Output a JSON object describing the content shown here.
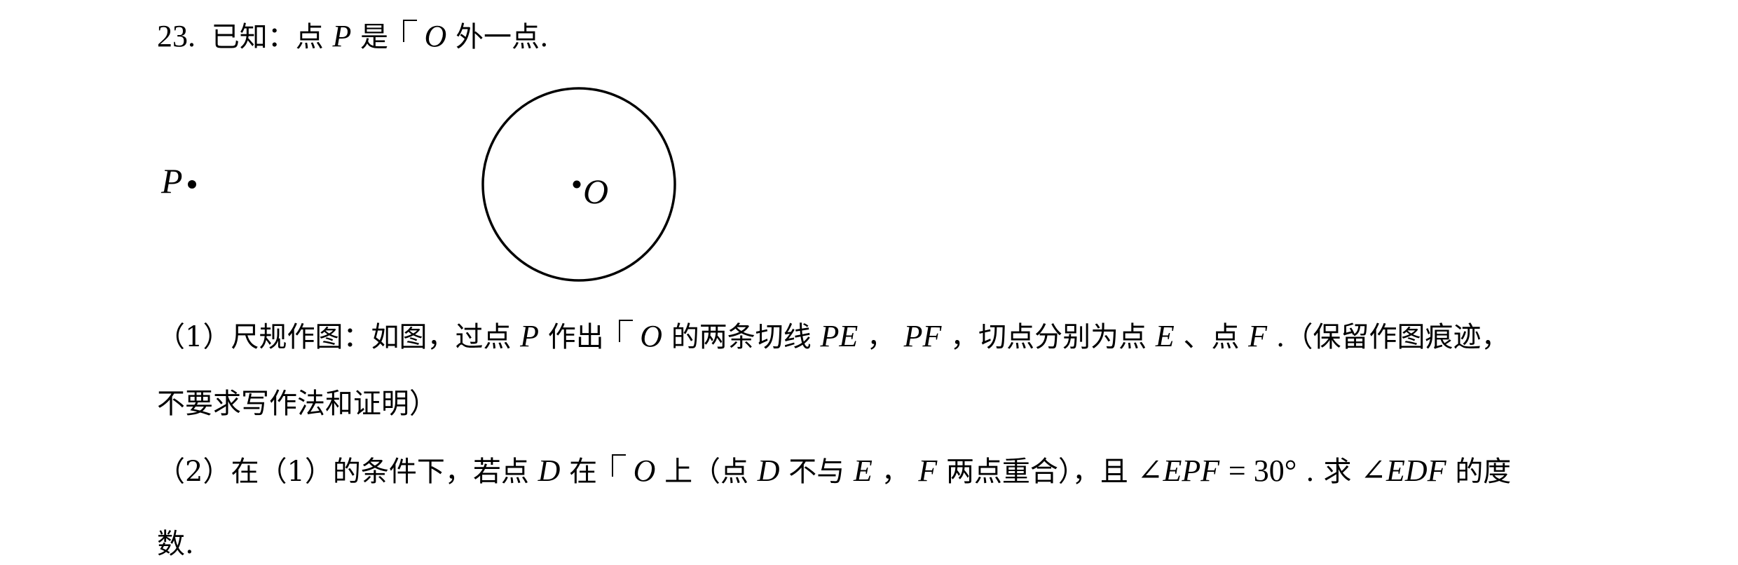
{
  "problem": {
    "number": "23.",
    "intro_1": "已知：点",
    "var_p": "P",
    "intro_2": "是",
    "circle_o": "O",
    "intro_3": "外一点."
  },
  "figure": {
    "point_p_label": "P",
    "center_label": "O"
  },
  "part1": {
    "prefix": "（1）尺规作图：如图，过点",
    "p": "P",
    "mid_1": "作出",
    "o": "O",
    "mid_2": "的两条切线",
    "pe": "PE",
    "sep_1": "，",
    "pf": "PF",
    "mid_3": "，切点分别为点",
    "e": "E",
    "mid_4": "、点",
    "f": "F",
    "suffix": ".（保留作图痕迹，",
    "line2": "不要求写作法和证明）"
  },
  "part2": {
    "prefix": "（2）在（1）的条件下，若点",
    "d": "D",
    "mid_1": "在",
    "o": "O",
    "mid_2": "上（点",
    "d2": "D",
    "mid_3": "不与",
    "e": "E",
    "sep": "，",
    "f": "F",
    "mid_4": "两点重合），且",
    "angle_epf": "∠EPF",
    "eq": " = ",
    "angle_value": "30°",
    "mid_5": ".  求",
    "angle_edf": "∠EDF",
    "mid_6": "的度",
    "line2": "数."
  }
}
